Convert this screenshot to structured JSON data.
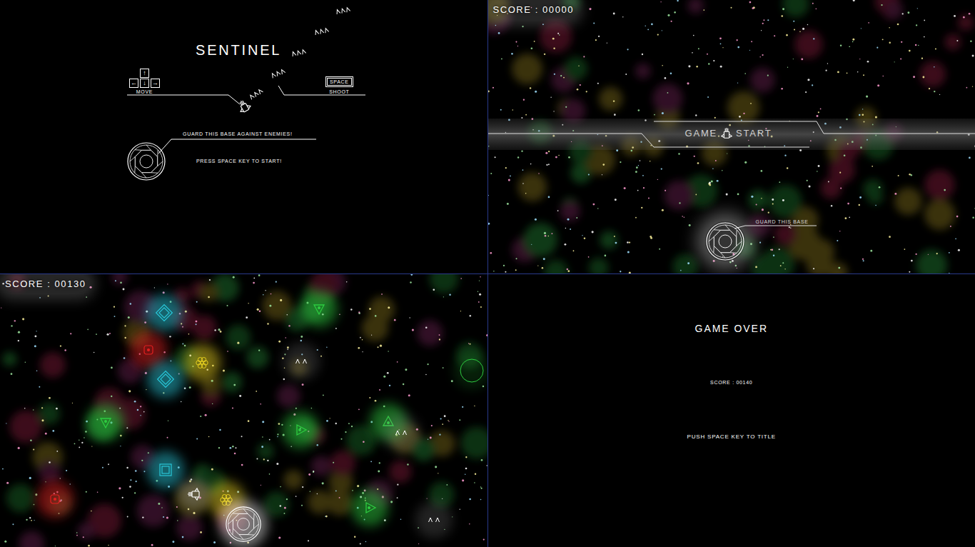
{
  "title_screen": {
    "title": "SENTINEL",
    "keys": [
      {
        "label": "↑"
      },
      {
        "label": "←"
      },
      {
        "label": "↓"
      },
      {
        "label": "→"
      }
    ],
    "move_label": "MOVE",
    "shoot_key": "SPACE",
    "shoot_label": "SHOOT",
    "hint": "GUARD THIS BASE AGAINST ENEMIES!",
    "prompt": "PRESS SPACE KEY TO START!"
  },
  "start_screen": {
    "score": "SCORE : 00000",
    "banner_left": "GAME",
    "banner_right": "START",
    "base_label": "GUARD THIS BASE"
  },
  "play_screen": {
    "score": "SCORE : 00130",
    "entities": [
      {
        "kind": "diamond",
        "color": "#29c6d8",
        "facing": "up"
      },
      {
        "kind": "core",
        "color": "#e02020",
        "facing": "up"
      },
      {
        "kind": "flower",
        "color": "#e8d020",
        "facing": "up"
      },
      {
        "kind": "diamond",
        "color": "#29c6d8",
        "facing": "up"
      },
      {
        "kind": "triangle",
        "color": "#2ecc40",
        "facing": "down"
      },
      {
        "kind": "chevrons",
        "color": "#ffffff",
        "facing": "up"
      },
      {
        "kind": "triangle",
        "color": "#2ecc40",
        "facing": "down"
      },
      {
        "kind": "triangle",
        "color": "#2ecc40",
        "facing": "right"
      },
      {
        "kind": "triangle",
        "color": "#2ecc40",
        "facing": "up"
      },
      {
        "kind": "chevrons",
        "color": "#ffffff",
        "facing": "up"
      },
      {
        "kind": "square",
        "color": "#29c6d8",
        "facing": "up"
      },
      {
        "kind": "core",
        "color": "#e02020",
        "facing": "up"
      },
      {
        "kind": "flower",
        "color": "#e8d020",
        "facing": "up"
      },
      {
        "kind": "triangle",
        "color": "#2ecc40",
        "facing": "right"
      },
      {
        "kind": "chevrons",
        "color": "#ffffff",
        "facing": "up"
      },
      {
        "kind": "ring",
        "color": "#2ecc40",
        "facing": "up"
      }
    ]
  },
  "game_over_screen": {
    "title": "GAME OVER",
    "score": "SCORE : 00140",
    "prompt": "PUSH SPACE KEY TO TITLE"
  }
}
